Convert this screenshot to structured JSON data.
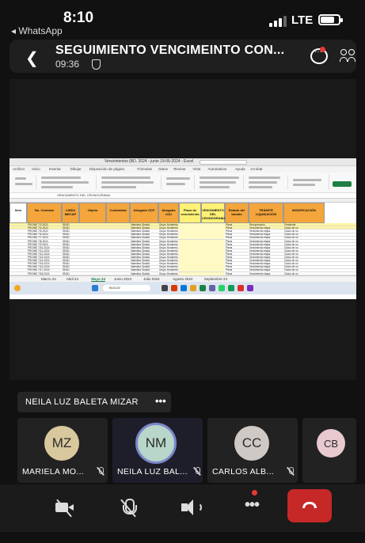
{
  "status_bar": {
    "time": "8:10",
    "back_app": "◂ WhatsApp",
    "network": "LTE",
    "signal_bars": 3,
    "battery_level": 0.75
  },
  "call_header": {
    "title": "SEGUIMIENTO VENCIMEINTO CON...",
    "timer": "09:36"
  },
  "shared_screen": {
    "excel": {
      "title": "Vencimientos (BD. 2024 - junio 19-06-2024 - Excel",
      "tabs": [
        "Archivo",
        "Inicio",
        "Insertar",
        "Dibujar",
        "Disposición de página",
        "Fórmulas",
        "Datos",
        "Revisar",
        "Vista",
        "Automatizar",
        "Ayuda",
        "Acrobat"
      ],
      "formula_text": "VENCIMIENTO DEL CRONOGRAMA",
      "headers": [
        "Item",
        "No. Contrato",
        "LINEA MECAP",
        "Objeto",
        "Contratista",
        "Abogado SCP",
        "Abogado UJU",
        "Plazo de vencimiento",
        "VENCIMIENTO DEL CRONOGRAMA",
        "Estado del trámite",
        "TRÁMITE LIQUIDACIÓN",
        "MODIFICACIÓN"
      ],
      "rows": [
        [
          "PROINE 7/3-2024",
          "SEAD",
          "Valentina Giraldo",
          "Grupo Humberto",
          "Plena",
          "Recuperación",
          "Pendiente"
        ],
        [
          "PROINE 7/4-2024",
          "SEAD",
          "Valentina Giraldo",
          "Grupo Humberto",
          "Plena",
          "Vencimiento etapa",
          "Ciclos de no"
        ],
        [
          "PROINE 7/5-2024",
          "SEAD",
          "Valentina Giraldo",
          "Grupo Humberto",
          "Plena",
          "Vencimiento etapa",
          "Ciclos de no"
        ],
        [
          "PROINE 7/6-2024",
          "SEAD",
          "Valentina Giraldo",
          "Grupo Humberto",
          "Plena",
          "Vencimiento etapa",
          "Ciclos de no"
        ],
        [
          "PROINE 7/7-2024",
          "SEAD",
          "Valentina Giraldo",
          "Grupo Humberto",
          "Plena",
          "Vencimiento etapa",
          "Ciclos de no"
        ],
        [
          "PROINE 7/8-2024",
          "SEAD",
          "Valentina Giraldo",
          "Grupo Humberto",
          "Plena",
          "Vencimiento etapa",
          "Ciclos de no"
        ],
        [
          "PROINE 7/9-2024",
          "SEAD",
          "Valentina Giraldo",
          "Grupo Humberto",
          "Plena",
          "Vencimiento etapa",
          "Ciclos de no"
        ],
        [
          "PROINE 7/10-2024",
          "SEAD",
          "Valentina Giraldo",
          "Grupo Humberto",
          "Plena",
          "Vencimiento etapa",
          "Ciclos de no"
        ],
        [
          "PROINE 7/11-2024",
          "SEAD",
          "Valentina Giraldo",
          "Grupo Humberto",
          "Plena",
          "Vencimiento etapa",
          "Ciclos de no"
        ],
        [
          "PROINE 7/12-2024",
          "SEAD",
          "Valentina Giraldo",
          "Grupo Humberto",
          "Plena",
          "Vencimiento etapa",
          "Ciclos de no"
        ],
        [
          "PROINE 7/13-2024",
          "SEAD",
          "Valentina Giraldo",
          "Grupo Humberto",
          "Plena",
          "Vencimiento etapa",
          "Ciclos de no"
        ],
        [
          "PROINE 7/14-2024",
          "SEAD",
          "Valentina Giraldo",
          "Grupo Humberto",
          "Plena",
          "Vencimiento etapa",
          "Ciclos de no"
        ],
        [
          "PROINE 7/15-2024",
          "SEAD",
          "Valentina Giraldo",
          "Grupo Humberto",
          "Plena",
          "Vencimiento etapa",
          "Ciclos de no"
        ],
        [
          "PROINE 7/16-2024",
          "SEAD",
          "Valentina Giraldo",
          "Grupo Humberto",
          "Plena",
          "Vencimiento etapa",
          "Ciclos de no"
        ],
        [
          "PROINE 7/17-2024",
          "SEAD",
          "Valentina Giraldo",
          "Grupo Humberto",
          "Plena",
          "Vencimiento etapa",
          "Ciclos de no"
        ],
        [
          "PROINE 7/18-2024",
          "SEAD",
          "Valentina Giraldo",
          "Grupo Humberto",
          "Plena",
          "Vencimiento etapa",
          "Ciclos de no"
        ]
      ],
      "sheet_tabs": [
        "Marzo 24",
        "Abril 24",
        "Mayo 24",
        "Junio 2024",
        "Julio 2024",
        "Agosto 2024",
        "Septiembre 24"
      ],
      "active_sheet": "Mayo 24",
      "taskbar_search": "Buscar"
    }
  },
  "presenter_label": {
    "name": "NEILA LUZ BALETA MIZAR",
    "more": "•••"
  },
  "participants": [
    {
      "initials": "MZ",
      "name": "MARIELA MO...",
      "muted": true,
      "avatar_color": "#d9c89e"
    },
    {
      "initials": "NM",
      "name": "NEILA LUZ BAL...",
      "muted": true,
      "avatar_color": "#b8d6c9",
      "speaking": true
    },
    {
      "initials": "CC",
      "name": "CARLOS ALB...",
      "muted": true,
      "avatar_color": "#cfc9c5"
    },
    {
      "initials": "CB",
      "name": "",
      "muted": false,
      "avatar_color": "#e8c9cf"
    }
  ],
  "controls": {
    "camera": "camera-off",
    "mic": "mic-off",
    "speaker": "speaker",
    "more": "•••",
    "hangup": "hang-up"
  },
  "colors": {
    "hangup": "#c62828",
    "notification_dot": "#e53935",
    "excel_header_orange": "#f4a53c",
    "excel_header_yellow": "#fff176"
  }
}
